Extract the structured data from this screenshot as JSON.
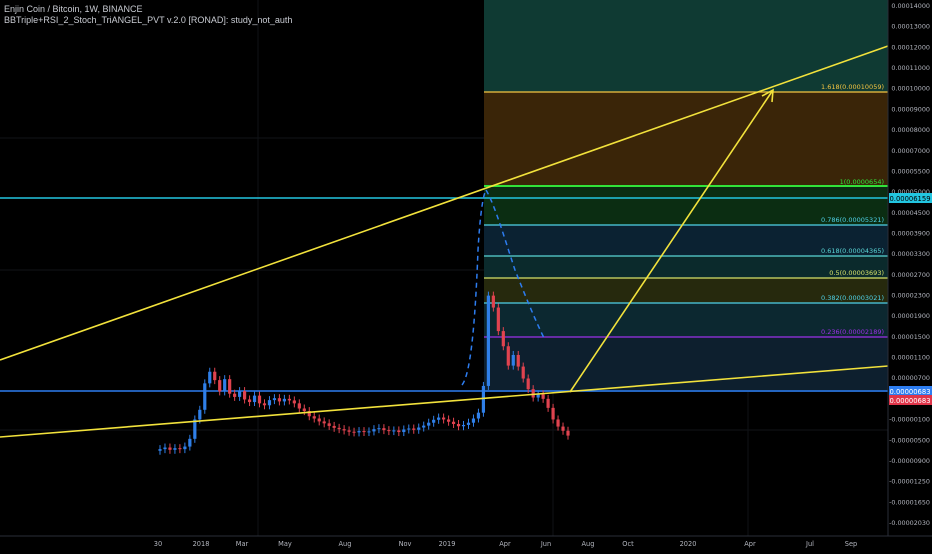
{
  "header": {
    "symbol_line": "Enjin Coin / Bitcoin, 1W, BINANCE",
    "indicator_line": "BBTriple+RSI_2_Stoch_TriANGEL_PVT v.2.0 [RONAD]: study_not_auth"
  },
  "price_axis": {
    "ticks": [
      "0.00014000",
      "0.00013000",
      "0.00012000",
      "0.00011000",
      "0.00010000",
      "0.00009000",
      "0.00008000",
      "0.00007000",
      "0.00005500",
      "0.00005000",
      "0.00004500",
      "0.00003900",
      "0.00003300",
      "0.00002700",
      "0.00002300",
      "0.00001900",
      "0.00001500",
      "0.00001100",
      "0.00000700",
      "0.00000300",
      "-0.00000100",
      "-0.00000500",
      "-0.00000900",
      "-0.00001250",
      "-0.00001650",
      "-0.00002030"
    ],
    "badges": [
      {
        "label": "0.00006159",
        "color": "#22c5e0"
      },
      {
        "label": "0.00000683",
        "color": "#2d7df0"
      },
      {
        "label": "0.00000683",
        "color": "#e0354a"
      }
    ]
  },
  "time_axis": {
    "ticks": [
      "30",
      "2018",
      "Mar",
      "May",
      "Aug",
      "Nov",
      "2019",
      "Apr",
      "Jun",
      "Aug",
      "Oct",
      "2020",
      "Apr",
      "Jul",
      "Sep"
    ]
  },
  "fib_levels": [
    {
      "label": "1.618(0.00010059)",
      "color": "#f5c542"
    },
    {
      "label": "1(0.0000654)",
      "color": "#32e23a"
    },
    {
      "label": "0.786(0.00005321)",
      "color": "#4fd2e8"
    },
    {
      "label": "0.618(0.00004365)",
      "color": "#5ad6d6"
    },
    {
      "label": "0.5(0.00003693)",
      "color": "#d6e26a"
    },
    {
      "label": "0.382(0.00003021)",
      "color": "#4fd2e8"
    },
    {
      "label": "0.236(0.00002189)",
      "color": "#9b30e8"
    }
  ],
  "colors": {
    "background": "#000000",
    "up_candle": "#2f7fe8",
    "down_candle": "#e0434f",
    "trendline": "#f2e23c",
    "horizontal_cyan": "#22c5e0",
    "horizontal_blue": "#2d7df0"
  },
  "chart_data": {
    "type": "candlestick",
    "title": "Enjin Coin / Bitcoin, 1W, BINANCE",
    "ylim": [
      -2.03e-05,
      0.00014
    ],
    "candles": [
      {
        "o": 2.1e-06,
        "c": 2.6e-06
      },
      {
        "o": 2.6e-06,
        "c": 3.1e-06
      },
      {
        "o": 3.1e-06,
        "c": 2.4e-06
      },
      {
        "o": 2.4e-06,
        "c": 2.9e-06
      },
      {
        "o": 2.9e-06,
        "c": 2.6e-06
      },
      {
        "o": 2.6e-06,
        "c": 3.4e-06
      },
      {
        "o": 3.4e-06,
        "c": 5.8e-06
      },
      {
        "o": 5.8e-06,
        "c": 1.18e-05
      },
      {
        "o": 1.18e-05,
        "c": 1.48e-05
      },
      {
        "o": 1.48e-05,
        "c": 2.3e-05
      },
      {
        "o": 2.3e-05,
        "c": 2.66e-05
      },
      {
        "o": 2.66e-05,
        "c": 2.4e-05
      },
      {
        "o": 2.4e-05,
        "c": 2.05e-05
      },
      {
        "o": 2.05e-05,
        "c": 2.43e-05
      },
      {
        "o": 2.43e-05,
        "c": 1.98e-05
      },
      {
        "o": 1.98e-05,
        "c": 1.88e-05
      },
      {
        "o": 1.88e-05,
        "c": 2.06e-05
      },
      {
        "o": 2.06e-05,
        "c": 1.8e-05
      },
      {
        "o": 1.8e-05,
        "c": 1.72e-05
      },
      {
        "o": 1.72e-05,
        "c": 1.92e-05
      },
      {
        "o": 1.92e-05,
        "c": 1.68e-05
      },
      {
        "o": 1.68e-05,
        "c": 1.62e-05
      },
      {
        "o": 1.62e-05,
        "c": 1.78e-05
      },
      {
        "o": 1.78e-05,
        "c": 1.84e-05
      },
      {
        "o": 1.84e-05,
        "c": 1.74e-05
      },
      {
        "o": 1.74e-05,
        "c": 1.82e-05
      },
      {
        "o": 1.82e-05,
        "c": 1.77e-05
      },
      {
        "o": 1.77e-05,
        "c": 1.68e-05
      },
      {
        "o": 1.68e-05,
        "c": 1.52e-05
      },
      {
        "o": 1.52e-05,
        "c": 1.44e-05
      },
      {
        "o": 1.44e-05,
        "c": 1.28e-05
      },
      {
        "o": 1.28e-05,
        "c": 1.21e-05
      },
      {
        "o": 1.21e-05,
        "c": 1.12e-05
      },
      {
        "o": 1.12e-05,
        "c": 1.06e-05
      },
      {
        "o": 1.06e-05,
        "c": 9.8e-06
      },
      {
        "o": 9.8e-06,
        "c": 9.2e-06
      },
      {
        "o": 9.2e-06,
        "c": 8.8e-06
      },
      {
        "o": 8.8e-06,
        "c": 8.4e-06
      },
      {
        "o": 8.4e-06,
        "c": 8e-06
      },
      {
        "o": 8e-06,
        "c": 7.8e-06
      },
      {
        "o": 7.8e-06,
        "c": 8.2e-06
      },
      {
        "o": 8.2e-06,
        "c": 7.9e-06
      },
      {
        "o": 7.9e-06,
        "c": 8.1e-06
      },
      {
        "o": 8.1e-06,
        "c": 8.8e-06
      },
      {
        "o": 8.8e-06,
        "c": 9.1e-06
      },
      {
        "o": 9.1e-06,
        "c": 8.5e-06
      },
      {
        "o": 8.5e-06,
        "c": 8.2e-06
      },
      {
        "o": 8.2e-06,
        "c": 8.4e-06
      },
      {
        "o": 8.4e-06,
        "c": 7.9e-06
      },
      {
        "o": 7.9e-06,
        "c": 8.7e-06
      },
      {
        "o": 8.7e-06,
        "c": 9e-06
      },
      {
        "o": 9e-06,
        "c": 8.6e-06
      },
      {
        "o": 8.6e-06,
        "c": 9.3e-06
      },
      {
        "o": 9.3e-06,
        "c": 9.9e-06
      },
      {
        "o": 9.9e-06,
        "c": 1.08e-05
      },
      {
        "o": 1.08e-05,
        "c": 1.17e-05
      },
      {
        "o": 1.17e-05,
        "c": 1.24e-05
      },
      {
        "o": 1.24e-05,
        "c": 1.18e-05
      },
      {
        "o": 1.18e-05,
        "c": 1.11e-05
      },
      {
        "o": 1.11e-05,
        "c": 1.04e-05
      },
      {
        "o": 1.04e-05,
        "c": 9.7e-06
      },
      {
        "o": 9.7e-06,
        "c": 1.01e-05
      },
      {
        "o": 1.01e-05,
        "c": 1.08e-05
      },
      {
        "o": 1.08e-05,
        "c": 1.21e-05
      },
      {
        "o": 1.21e-05,
        "c": 1.39e-05
      },
      {
        "o": 1.39e-05,
        "c": 2.22e-05
      },
      {
        "o": 2.22e-05,
        "c": 5.02e-05
      },
      {
        "o": 5.02e-05,
        "c": 4.65e-05
      },
      {
        "o": 4.65e-05,
        "c": 3.92e-05
      },
      {
        "o": 3.92e-05,
        "c": 3.45e-05
      },
      {
        "o": 3.45e-05,
        "c": 2.85e-05
      },
      {
        "o": 2.85e-05,
        "c": 3.18e-05
      },
      {
        "o": 3.18e-05,
        "c": 2.82e-05
      },
      {
        "o": 2.82e-05,
        "c": 2.45e-05
      },
      {
        "o": 2.45e-05,
        "c": 2.12e-05
      },
      {
        "o": 2.12e-05,
        "c": 1.86e-05
      },
      {
        "o": 1.86e-05,
        "c": 1.96e-05
      },
      {
        "o": 1.96e-05,
        "c": 1.82e-05
      },
      {
        "o": 1.82e-05,
        "c": 1.54e-05
      },
      {
        "o": 1.54e-05,
        "c": 1.18e-05
      },
      {
        "o": 1.18e-05,
        "c": 9.6e-06
      },
      {
        "o": 9.6e-06,
        "c": 8.3e-06
      },
      {
        "o": 8.3e-06,
        "c": 6.8e-06
      }
    ]
  }
}
